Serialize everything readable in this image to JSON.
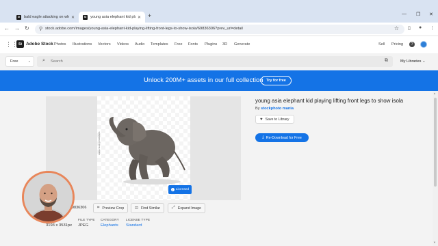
{
  "browser": {
    "tabs": [
      {
        "title": "bald eagle attacking on white",
        "active": false,
        "favicon": "St"
      },
      {
        "title": "young asia elephant kid playin",
        "active": true,
        "favicon": "St"
      }
    ],
    "url": "stock.adobe.com/images/young-asia-elephant-kid-playing-lifting-front-legs-to-show-isola/69836306?prev_url=detail"
  },
  "stock_nav": {
    "logo_mark": "St",
    "logo_text": "Adobe Stock",
    "links": [
      "Photos",
      "Illustrations",
      "Vectors",
      "Videos",
      "Audio",
      "Templates",
      "Free",
      "Fonts",
      "Plugins",
      "3D",
      "Generate"
    ],
    "sell": "Sell",
    "pricing": "Pricing",
    "help": "?"
  },
  "search": {
    "filter_value": "Free",
    "placeholder": "Search",
    "my_libraries": "My Libraries"
  },
  "banner": {
    "text": "Unlock 200M+ assets in our full collection",
    "cta": "Try for free"
  },
  "asset": {
    "title": "young asia elephant kid playing lifting front legs to show isola",
    "by_prefix": "By",
    "author": "stockphoto mania",
    "save_label": "Save to Library",
    "redownload_label": "Re-Download for Free",
    "licensed_badge": "Licensed",
    "watermark": "Adobe Stock | #69836306",
    "id_partial": "9836306",
    "preview_crop": "Preview Crop",
    "find_similar": "Find Similar",
    "expand_image": "Expand Image",
    "dimensions": "3193 x 3531px",
    "meta": [
      {
        "key": "FILE TYPE",
        "value": "JPEG",
        "link": false
      },
      {
        "key": "CATEGORY",
        "value": "Elephants",
        "link": true
      },
      {
        "key": "LICENSE TYPE",
        "value": "Standard",
        "link": true
      }
    ]
  },
  "colors": {
    "accent": "#1473e6",
    "webcam_border": "#e8865a"
  }
}
